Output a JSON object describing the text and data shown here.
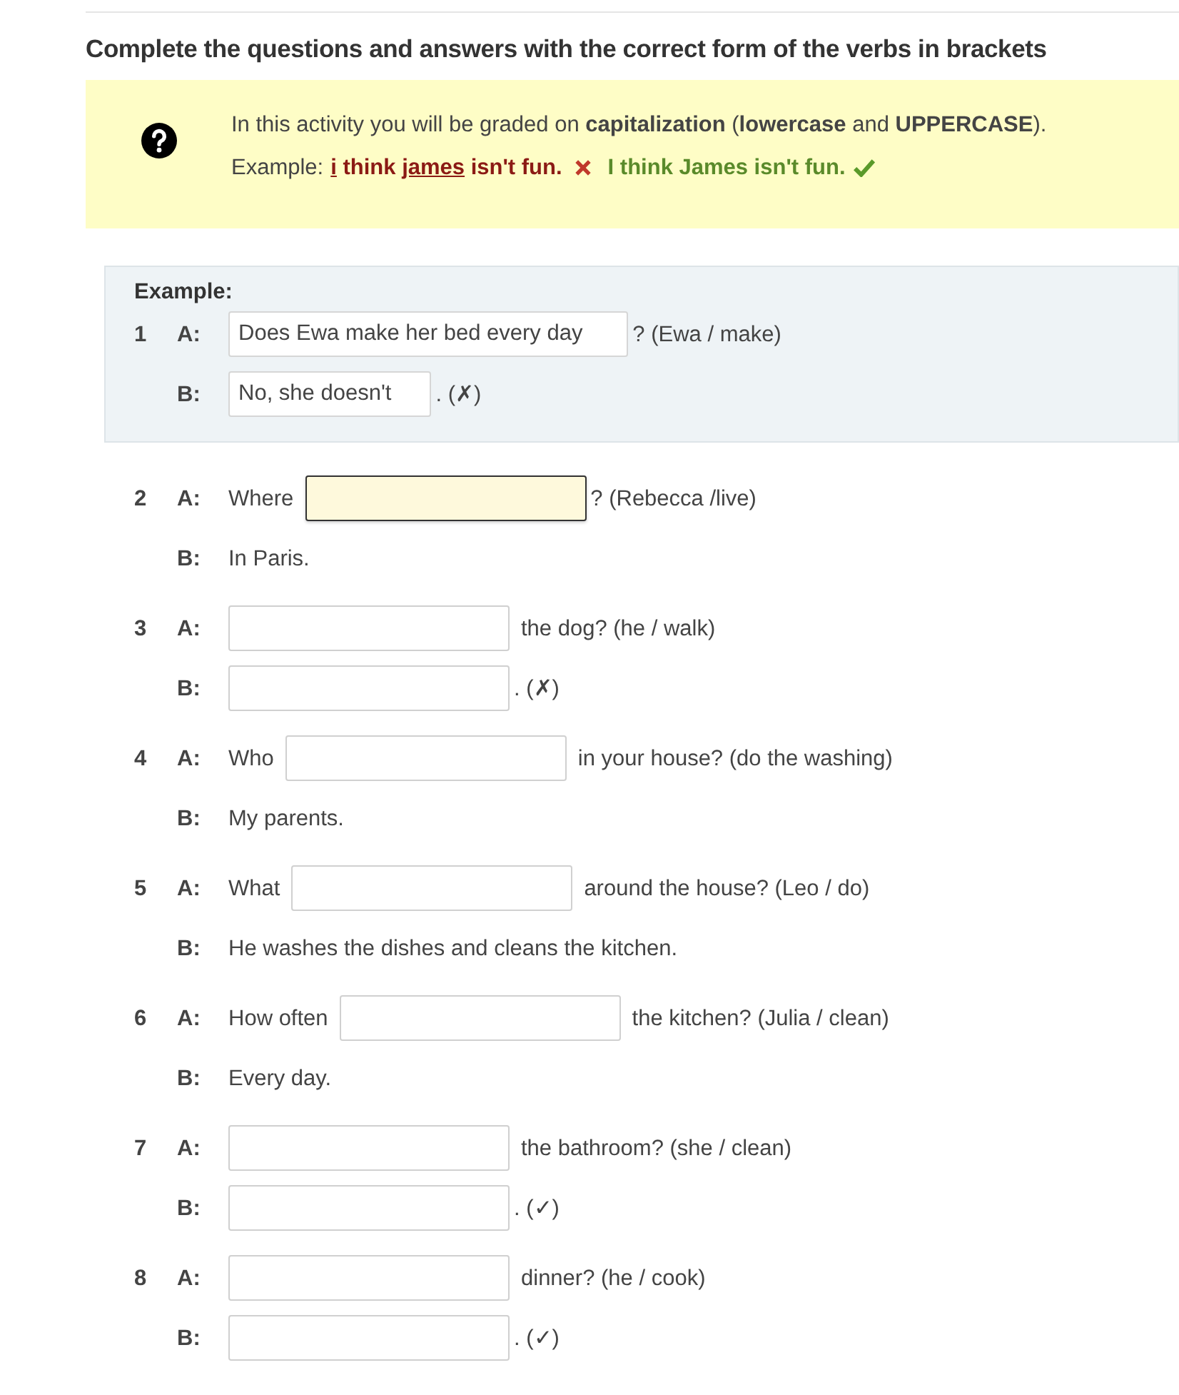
{
  "title": "Complete the questions and answers with the correct form of the verbs in brackets",
  "notice": {
    "text": "In this activity you will be graded on **capitalization** (**lowercase** and **UPPERCASE**).",
    "example_label": "Example:",
    "wrong_example": [
      {
        "text": "i",
        "underlined": true
      },
      {
        "text": " think ",
        "underlined": false
      },
      {
        "text": "james",
        "underlined": true
      },
      {
        "text": " isn't fun.",
        "underlined": false
      }
    ],
    "correct_example": "I think James isn't fun."
  },
  "example": {
    "heading": "Example:",
    "number": "1",
    "lines": [
      {
        "speaker": "A:",
        "parts": [
          {
            "kind": "field",
            "value": "Does Ewa make her bed every day",
            "focused": false
          },
          {
            "kind": "text",
            "text": "? (Ewa / make)"
          }
        ]
      },
      {
        "speaker": "B:",
        "parts": [
          {
            "kind": "field",
            "value": "No, she doesn't",
            "focused": false
          },
          {
            "kind": "text",
            "text": ". (✗)"
          }
        ]
      }
    ]
  },
  "questions": [
    {
      "number": "2",
      "lines": [
        {
          "speaker": "A:",
          "parts": [
            {
              "kind": "text",
              "text": "Where"
            },
            {
              "kind": "field",
              "focused": true
            },
            {
              "kind": "text",
              "text": "? (Rebecca /live)"
            }
          ]
        },
        {
          "speaker": "B:",
          "parts": [
            {
              "kind": "text",
              "text": "In Paris."
            }
          ]
        }
      ]
    },
    {
      "number": "3",
      "lines": [
        {
          "speaker": "A:",
          "parts": [
            {
              "kind": "field",
              "focused": false
            },
            {
              "kind": "text",
              "text": "the dog? (he / walk)"
            }
          ]
        },
        {
          "speaker": "B:",
          "parts": [
            {
              "kind": "field",
              "focused": false
            },
            {
              "kind": "text",
              "text": ". (✗)"
            }
          ]
        }
      ]
    },
    {
      "number": "4",
      "lines": [
        {
          "speaker": "A:",
          "parts": [
            {
              "kind": "text",
              "text": "Who"
            },
            {
              "kind": "field",
              "focused": false
            },
            {
              "kind": "text",
              "text": "in your house? (do the washing)"
            }
          ]
        },
        {
          "speaker": "B:",
          "parts": [
            {
              "kind": "text",
              "text": "My parents."
            }
          ]
        }
      ]
    },
    {
      "number": "5",
      "lines": [
        {
          "speaker": "A:",
          "parts": [
            {
              "kind": "text",
              "text": "What"
            },
            {
              "kind": "field",
              "focused": false
            },
            {
              "kind": "text",
              "text": "around the house? (Leo / do)"
            }
          ]
        },
        {
          "speaker": "B:",
          "parts": [
            {
              "kind": "text",
              "text": "He washes the dishes and cleans the kitchen."
            }
          ]
        }
      ]
    },
    {
      "number": "6",
      "lines": [
        {
          "speaker": "A:",
          "parts": [
            {
              "kind": "text",
              "text": "How often"
            },
            {
              "kind": "field",
              "focused": false
            },
            {
              "kind": "text",
              "text": "the kitchen? (Julia / clean)"
            }
          ]
        },
        {
          "speaker": "B:",
          "parts": [
            {
              "kind": "text",
              "text": "Every day."
            }
          ]
        }
      ]
    },
    {
      "number": "7",
      "lines": [
        {
          "speaker": "A:",
          "parts": [
            {
              "kind": "field",
              "focused": false
            },
            {
              "kind": "text",
              "text": "the bathroom? (she / clean)"
            }
          ]
        },
        {
          "speaker": "B:",
          "parts": [
            {
              "kind": "field",
              "focused": false
            },
            {
              "kind": "text",
              "text": ". (✓)"
            }
          ]
        }
      ]
    },
    {
      "number": "8",
      "lines": [
        {
          "speaker": "A:",
          "parts": [
            {
              "kind": "field",
              "focused": false
            },
            {
              "kind": "text",
              "text": "dinner? (he / cook)"
            }
          ]
        },
        {
          "speaker": "B:",
          "parts": [
            {
              "kind": "field",
              "focused": false
            },
            {
              "kind": "text",
              "text": ". (✓)"
            }
          ]
        }
      ]
    }
  ]
}
